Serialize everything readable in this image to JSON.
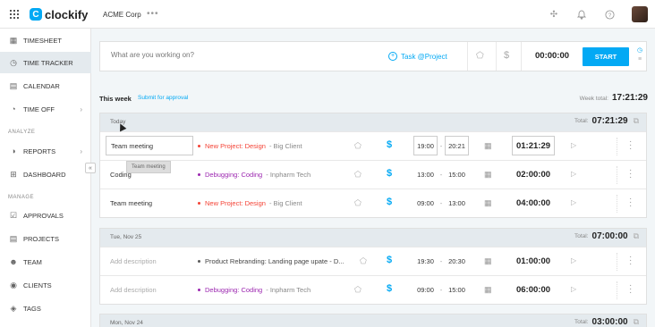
{
  "topbar": {
    "logo_mark": "C",
    "logo_text": "clockify",
    "workspace": "ACME Corp",
    "workspace_menu": "•••",
    "icons": [
      "apps-grid-icon",
      "puzzle-icon",
      "bell-icon",
      "help-icon"
    ]
  },
  "sidebar": {
    "items": [
      {
        "label": "TIMESHEET",
        "icon": "timesheet-icon"
      },
      {
        "label": "TIME TRACKER",
        "icon": "clock-icon",
        "active": true
      },
      {
        "label": "CALENDAR",
        "icon": "calendar-icon"
      },
      {
        "label": "TIME OFF",
        "icon": "time-off-icon"
      },
      {
        "label": "REPORTS",
        "icon": "reports-icon"
      },
      {
        "label": "DASHBOARD",
        "icon": "dashboard-icon"
      },
      {
        "label": "APPROVALS",
        "icon": "approvals-icon"
      },
      {
        "label": "PROJECTS",
        "icon": "projects-icon"
      },
      {
        "label": "TEAM",
        "icon": "team-icon"
      },
      {
        "label": "CLIENTS",
        "icon": "clients-icon"
      },
      {
        "label": "TAGS",
        "icon": "tag-icon"
      }
    ],
    "sections": {
      "analyze": "ANALYZE",
      "manage": "MANAGE"
    },
    "collapse": "«"
  },
  "timer": {
    "placeholder": "What are you working on?",
    "project_label": "Task @Project",
    "time": "00:00:00",
    "start_label": "START"
  },
  "week": {
    "title": "This week",
    "submit": "Submit for approval",
    "total_label": "Week total:",
    "total": "17:21:29"
  },
  "colors": {
    "accent": "#03a9f4",
    "red": "#f44336",
    "purple": "#9c27b0",
    "gray": "#5a5a5a"
  },
  "days": [
    {
      "label": "Today",
      "total_label": "Total:",
      "total": "07:21:29",
      "entries": [
        {
          "description": "Team meeting",
          "project": "New Project: Design",
          "project_color": "#f44336",
          "client": "Big Client",
          "start": "19:00",
          "end": "20:21",
          "duration": "01:21:29"
        },
        {
          "description": "Coding",
          "project": "Debugging: Coding",
          "project_color": "#9c27b0",
          "client": "Inpharm Tech",
          "start": "13:00",
          "end": "15:00",
          "duration": "02:00:00"
        },
        {
          "description": "Team meeting",
          "project": "New Project: Design",
          "project_color": "#f44336",
          "client": "Big Client",
          "start": "09:00",
          "end": "13:00",
          "duration": "04:00:00"
        }
      ]
    },
    {
      "label": "Tue, Nov 25",
      "total_label": "Total:",
      "total": "07:00:00",
      "entries": [
        {
          "description": "Add description",
          "project": "Product Rebranding: Landing page upate - D...",
          "project_color": "#5a5a5a",
          "client": "",
          "start": "19:30",
          "end": "20:30",
          "duration": "01:00:00"
        },
        {
          "description": "Add description",
          "project": "Debugging: Coding",
          "project_color": "#9c27b0",
          "client": "Inpharm Tech",
          "start": "09:00",
          "end": "15:00",
          "duration": "06:00:00"
        }
      ]
    },
    {
      "label": "Mon, Nov 24",
      "total_label": "Total:",
      "total": "03:00:00"
    }
  ],
  "tooltip": "Team meeting"
}
